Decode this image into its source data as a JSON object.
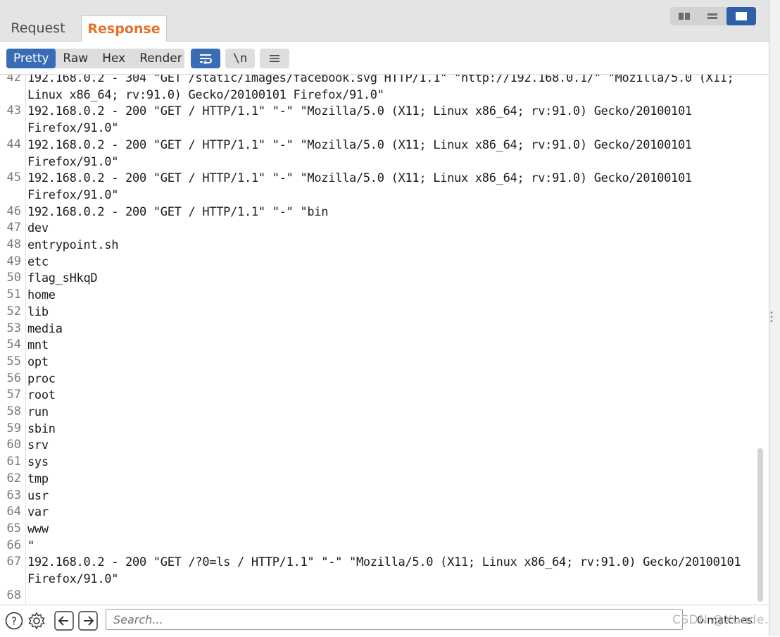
{
  "tabs": {
    "request": "Request",
    "response": "Response"
  },
  "layout_buttons": [
    "split-horizontal-icon",
    "split-vertical-icon",
    "single-pane-icon"
  ],
  "view_modes": [
    "Pretty",
    "Raw",
    "Hex",
    "Render"
  ],
  "active_view": "Pretty",
  "toolbar": {
    "wrap_icon": "word-wrap-icon",
    "newline_label": "\\n",
    "menu_icon": "menu-icon"
  },
  "lines": [
    {
      "num": "42",
      "text": "192.168.0.2 - 304 \"GET /static/images/facebook.svg HTTP/1.1\" \"http://192.168.0.1/\" \"Mozilla/5.0 (X11; Linux x86_64; rv:91.0) Gecko/20100101 Firefox/91.0\""
    },
    {
      "num": "43",
      "text": "192.168.0.2 - 200 \"GET / HTTP/1.1\" \"-\" \"Mozilla/5.0 (X11; Linux x86_64; rv:91.0) Gecko/20100101 Firefox/91.0\""
    },
    {
      "num": "44",
      "text": "192.168.0.2 - 200 \"GET / HTTP/1.1\" \"-\" \"Mozilla/5.0 (X11; Linux x86_64; rv:91.0) Gecko/20100101 Firefox/91.0\""
    },
    {
      "num": "45",
      "text": "192.168.0.2 - 200 \"GET / HTTP/1.1\" \"-\" \"Mozilla/5.0 (X11; Linux x86_64; rv:91.0) Gecko/20100101 Firefox/91.0\""
    },
    {
      "num": "46",
      "text": "192.168.0.2 - 200 \"GET / HTTP/1.1\" \"-\" \"bin"
    },
    {
      "num": "47",
      "text": "dev"
    },
    {
      "num": "48",
      "text": "entrypoint.sh"
    },
    {
      "num": "49",
      "text": "etc"
    },
    {
      "num": "50",
      "text": "flag_sHkqD"
    },
    {
      "num": "51",
      "text": "home"
    },
    {
      "num": "52",
      "text": "lib"
    },
    {
      "num": "53",
      "text": "media"
    },
    {
      "num": "54",
      "text": "mnt"
    },
    {
      "num": "55",
      "text": "opt"
    },
    {
      "num": "56",
      "text": "proc"
    },
    {
      "num": "57",
      "text": "root"
    },
    {
      "num": "58",
      "text": "run"
    },
    {
      "num": "59",
      "text": "sbin"
    },
    {
      "num": "60",
      "text": "srv"
    },
    {
      "num": "61",
      "text": "sys"
    },
    {
      "num": "62",
      "text": "tmp"
    },
    {
      "num": "63",
      "text": "usr"
    },
    {
      "num": "64",
      "text": "var"
    },
    {
      "num": "65",
      "text": "www"
    },
    {
      "num": "66",
      "text": "\""
    },
    {
      "num": "67",
      "text": "192.168.0.2 - 200 \"GET /?0=ls / HTTP/1.1\" \"-\" \"Mozilla/5.0 (X11; Linux x86_64; rv:91.0) Gecko/20100101 Firefox/91.0\""
    },
    {
      "num": "68",
      "text": ""
    }
  ],
  "bottom": {
    "help_icon": "help-icon",
    "settings_icon": "gear-icon",
    "back_icon": "arrow-left-icon",
    "forward_icon": "arrow-right-icon",
    "search_placeholder": "Search...",
    "matches": "0 matches"
  },
  "watermark": "CSDN @Xuude."
}
